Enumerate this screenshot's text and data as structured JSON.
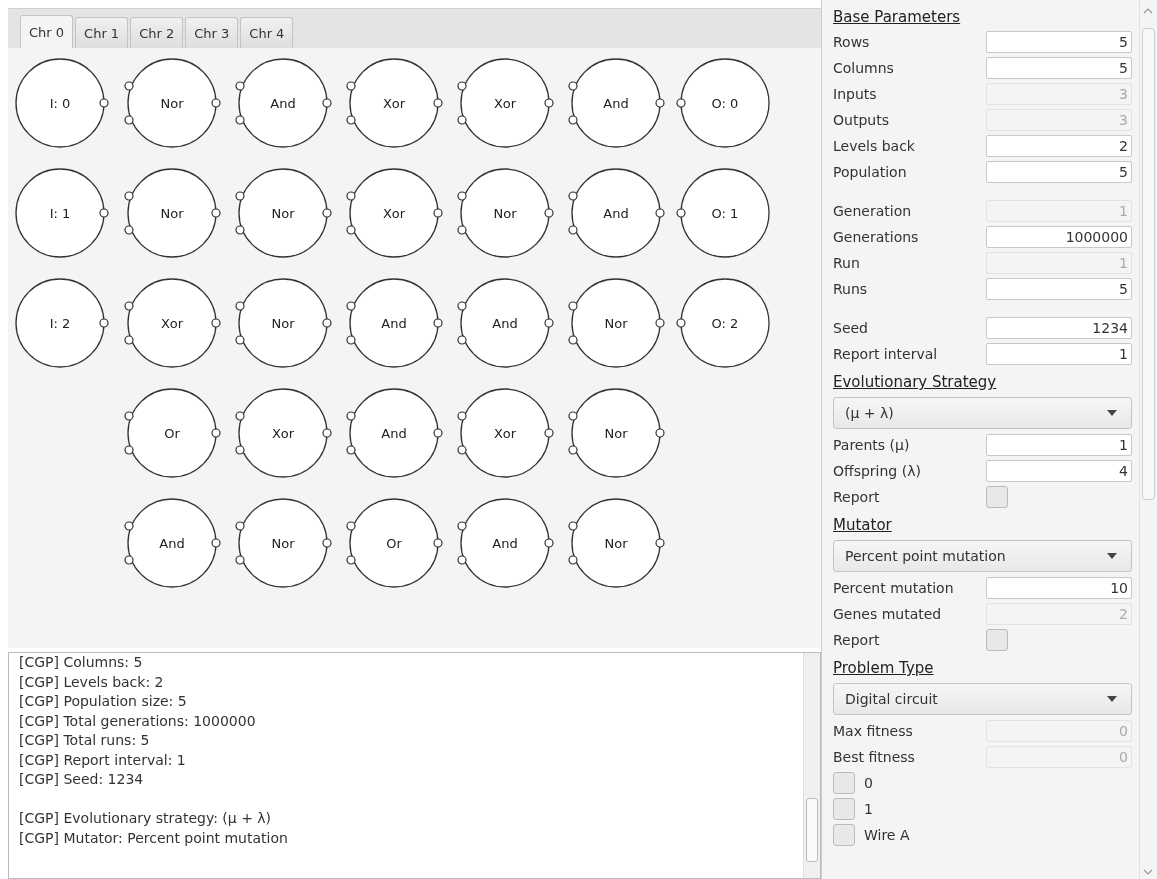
{
  "tabs": [
    {
      "label": "Chr 0",
      "selected": true
    },
    {
      "label": "Chr 1",
      "selected": false
    },
    {
      "label": "Chr 2",
      "selected": false
    },
    {
      "label": "Chr 3",
      "selected": false
    },
    {
      "label": "Chr 4",
      "selected": false
    }
  ],
  "grid": [
    [
      {
        "kind": "input",
        "label": "I: 0"
      },
      {
        "kind": "function",
        "label": "Nor"
      },
      {
        "kind": "function",
        "label": "And"
      },
      {
        "kind": "function",
        "label": "Xor"
      },
      {
        "kind": "function",
        "label": "Xor"
      },
      {
        "kind": "function",
        "label": "And"
      },
      {
        "kind": "output",
        "label": "O: 0"
      }
    ],
    [
      {
        "kind": "input",
        "label": "I: 1"
      },
      {
        "kind": "function",
        "label": "Nor"
      },
      {
        "kind": "function",
        "label": "Nor"
      },
      {
        "kind": "function",
        "label": "Xor"
      },
      {
        "kind": "function",
        "label": "Nor"
      },
      {
        "kind": "function",
        "label": "And"
      },
      {
        "kind": "output",
        "label": "O: 1"
      }
    ],
    [
      {
        "kind": "input",
        "label": "I: 2"
      },
      {
        "kind": "function",
        "label": "Xor"
      },
      {
        "kind": "function",
        "label": "Nor"
      },
      {
        "kind": "function",
        "label": "And"
      },
      {
        "kind": "function",
        "label": "And"
      },
      {
        "kind": "function",
        "label": "Nor"
      },
      {
        "kind": "output",
        "label": "O: 2"
      }
    ],
    [
      {
        "kind": "function",
        "label": "Or"
      },
      {
        "kind": "function",
        "label": "Xor"
      },
      {
        "kind": "function",
        "label": "And"
      },
      {
        "kind": "function",
        "label": "Xor"
      },
      {
        "kind": "function",
        "label": "Nor"
      }
    ],
    [
      {
        "kind": "function",
        "label": "And"
      },
      {
        "kind": "function",
        "label": "Nor"
      },
      {
        "kind": "function",
        "label": "Or"
      },
      {
        "kind": "function",
        "label": "And"
      },
      {
        "kind": "function",
        "label": "Nor"
      }
    ]
  ],
  "log": [
    [
      "[CGP] Columns: 5",
      "[CGP] Levels back: 2",
      "[CGP] Population size: 5",
      "[CGP] Total generations: 1000000",
      "[CGP] Total runs: 5",
      "[CGP] Report interval: 1",
      "[CGP] Seed: 1234"
    ],
    [
      "[CGP] Evolutionary strategy: (μ + λ)",
      "[CGP] Mutator: Percent point mutation"
    ]
  ],
  "panel": [
    [
      {
        "kind": "heading",
        "label": "Base Parameters"
      },
      {
        "kind": "field",
        "label": "Rows",
        "value": "5",
        "disabled": false
      },
      {
        "kind": "field",
        "label": "Columns",
        "value": "5",
        "disabled": false
      },
      {
        "kind": "field",
        "label": "Inputs",
        "value": "3",
        "disabled": true
      },
      {
        "kind": "field",
        "label": "Outputs",
        "value": "3",
        "disabled": true
      },
      {
        "kind": "field",
        "label": "Levels back",
        "value": "2",
        "disabled": false
      },
      {
        "kind": "field",
        "label": "Population",
        "value": "5",
        "disabled": false
      }
    ],
    [
      {
        "kind": "field",
        "label": "Generation",
        "value": "1",
        "disabled": true
      },
      {
        "kind": "field",
        "label": "Generations",
        "value": "1000000",
        "disabled": false
      },
      {
        "kind": "field",
        "label": "Run",
        "value": "1",
        "disabled": true
      },
      {
        "kind": "field",
        "label": "Runs",
        "value": "5",
        "disabled": false
      }
    ],
    [
      {
        "kind": "field",
        "label": "Seed",
        "value": "1234",
        "disabled": false
      },
      {
        "kind": "field",
        "label": "Report interval",
        "value": "1",
        "disabled": false
      },
      {
        "kind": "heading",
        "label": "Evolutionary Strategy"
      },
      {
        "kind": "dropdown",
        "value": "(μ + λ)"
      },
      {
        "kind": "field",
        "label": "Parents (μ)",
        "value": "1",
        "disabled": false
      },
      {
        "kind": "field",
        "label": "Offspring (λ)",
        "value": "4",
        "disabled": false
      },
      {
        "kind": "checkbox",
        "label": "Report",
        "checked": false
      },
      {
        "kind": "heading",
        "label": "Mutator"
      },
      {
        "kind": "dropdown",
        "value": "Percent point mutation"
      },
      {
        "kind": "field",
        "label": "Percent mutation",
        "value": "10",
        "disabled": false
      },
      {
        "kind": "field",
        "label": "Genes mutated",
        "value": "2",
        "disabled": true
      },
      {
        "kind": "checkbox",
        "label": "Report",
        "checked": false
      },
      {
        "kind": "heading",
        "label": "Problem Type"
      },
      {
        "kind": "dropdown",
        "value": "Digital circuit"
      },
      {
        "kind": "field",
        "label": "Max fitness",
        "value": "0",
        "disabled": true
      },
      {
        "kind": "field",
        "label": "Best fitness",
        "value": "0",
        "disabled": true
      },
      {
        "kind": "option",
        "label": "0",
        "checked": false
      },
      {
        "kind": "option",
        "label": "1",
        "checked": false
      },
      {
        "kind": "option",
        "label": "Wire A",
        "checked": false
      }
    ]
  ]
}
